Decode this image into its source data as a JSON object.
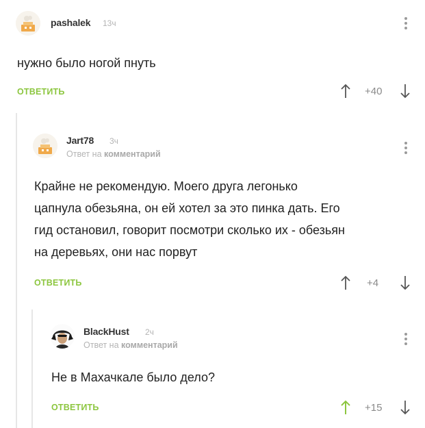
{
  "colors": {
    "accent_green": "#8cc63f",
    "text": "#222222",
    "muted": "#b4b4b4",
    "thread_line": "#e6e6e6"
  },
  "comments": [
    {
      "username": "pashalek",
      "time": "13ч",
      "reply_to": null,
      "text_lines": [
        "нужно было ногой пнуть"
      ],
      "reply_label": "ОТВЕТИТЬ",
      "rating": "+40",
      "upvoted": false,
      "avatar_icon": "default-avatar-icon"
    },
    {
      "username": "Jart78",
      "time": "3ч",
      "reply_to_prefix": "Ответ на",
      "reply_to_target": "комментарий",
      "text_lines": [
        "Крайне не рекомендую. Моего друга легонько",
        "цапнула обезьяна, он ей хотел за это пинка дать. Его",
        "гид остановил, говорит посмотри сколько их - обезьян",
        "на деревьях, они нас порвут"
      ],
      "reply_label": "ОТВЕТИТЬ",
      "rating": "+4",
      "upvoted": false,
      "avatar_icon": "default-avatar-icon"
    },
    {
      "username": "BlackHust",
      "time": "2ч",
      "reply_to_prefix": "Ответ на",
      "reply_to_target": "комментарий",
      "text_lines": [
        "Не в Махачкале было дело?"
      ],
      "reply_label": "ОТВЕТИТЬ",
      "rating": "+15",
      "upvoted": true,
      "avatar_icon": "dark-figure-avatar-icon"
    }
  ]
}
